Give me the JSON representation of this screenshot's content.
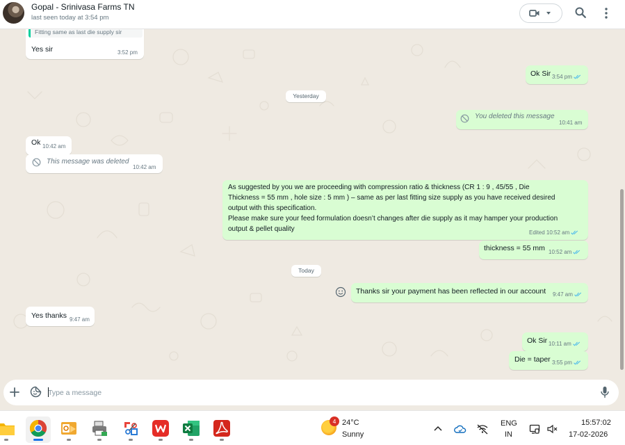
{
  "header": {
    "contact_name": "Gopal - Srinivasa Farms TN",
    "status": "last seen today at 3:54 pm"
  },
  "messages": [
    {
      "dir": "in",
      "quoted": "Fitting same as last die supply sir",
      "text": "Yes sir",
      "time": "3:52 pm"
    },
    {
      "dir": "out",
      "text": "Ok Sir",
      "time": "3:54 pm",
      "ticks": "read"
    },
    {
      "dir": "out",
      "deleted": true,
      "text": "You deleted this message",
      "time": "10:41 am"
    },
    {
      "dir": "in",
      "text": "Ok",
      "time": "10:42 am"
    },
    {
      "dir": "in",
      "deleted": true,
      "text": "This message was deleted",
      "time": "10:42 am"
    },
    {
      "dir": "out",
      "lines": [
        "As suggested by you we are proceeding with compression ratio & thickness (CR 1 : 9  , 45/55 , Die",
        "Thickness = 55 mm , hole size : 5 mm   ) – same as per last fitting size supply as you have received desired",
        "output with this specification.",
        "Please make sure your feed formulation doesn’t changes after die supply as it may hamper your production",
        "output & pellet quality"
      ],
      "time": "Edited 10:52 am",
      "ticks": "read"
    },
    {
      "dir": "out",
      "text": "thickness = 55 mm",
      "time": "10:52 am",
      "ticks": "read"
    },
    {
      "dir": "out",
      "text": "Thanks sir your payment has been reflected in our account",
      "time": "9:47 am",
      "ticks": "read"
    },
    {
      "dir": "in",
      "text": "Yes thanks",
      "time": "9:47 am"
    },
    {
      "dir": "out",
      "text": "Ok Sir",
      "time": "10:11 am",
      "ticks": "read"
    },
    {
      "dir": "out",
      "text": "Die = taper",
      "time": "3:55 pm",
      "ticks": "read"
    }
  ],
  "date_chips": [
    "Yesterday",
    "Today"
  ],
  "composer": {
    "placeholder": "Type a message"
  },
  "taskbar": {
    "weather_badge": "4",
    "temperature": "24°C",
    "condition": "Sunny",
    "language": "ENG",
    "region": "IN",
    "time": "15:57:02",
    "date": "17-02-2026"
  },
  "colors": {
    "incoming": "#ffffff",
    "outgoing": "#d9fdd3",
    "read_ticks": "#53bdeb",
    "wallpaper": "#efeae2"
  }
}
